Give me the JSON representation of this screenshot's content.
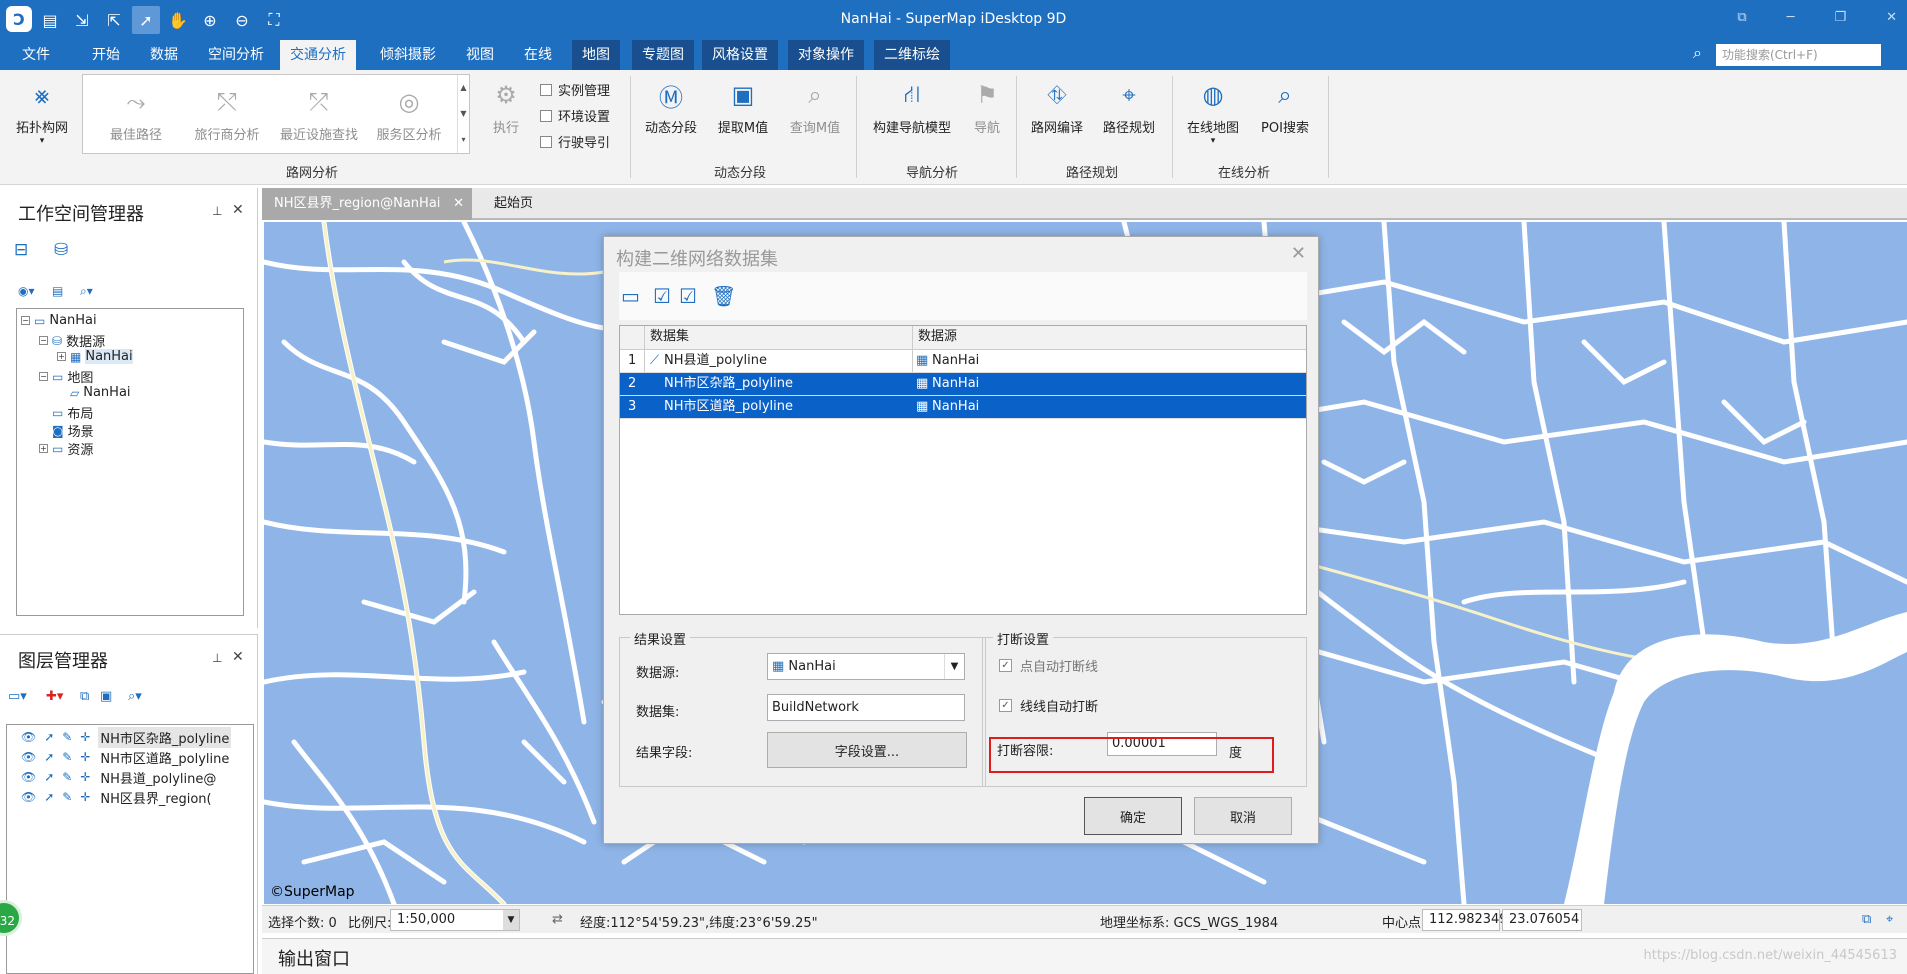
{
  "window": {
    "title": "NanHai - SuperMap iDesktop 9D"
  },
  "menu": {
    "items": [
      "文件",
      "开始",
      "数据",
      "空间分析",
      "交通分析",
      "倾斜摄影",
      "视图",
      "在线",
      "地图",
      "专题图",
      "风格设置",
      "对象操作",
      "二维标绘"
    ],
    "active": "交通分析",
    "search_placeholder": "功能搜索(Ctrl+F)"
  },
  "ribbon": {
    "topo": "拓扑构网",
    "gallery": [
      "最佳路径",
      "旅行商分析",
      "最近设施查找",
      "服务区分析"
    ],
    "execute": "执行",
    "checks": [
      "实例管理",
      "环境设置",
      "行驶导引"
    ],
    "group_network": "路网分析",
    "dynamic": [
      "动态分段",
      "提取M值",
      "查询M值"
    ],
    "group_dynamic": "动态分段",
    "nav": [
      "构建导航模型",
      "导航"
    ],
    "group_nav": "导航分析",
    "route": [
      "路网编译",
      "路径规划"
    ],
    "group_route": "路径规划",
    "online": [
      "在线地图",
      "POI搜索"
    ],
    "group_online": "在线分析"
  },
  "workspace": {
    "title": "工作空间管理器",
    "tree": {
      "root": "NanHai",
      "datasource": "数据源",
      "datasource_child": "NanHai",
      "map": "地图",
      "map_child": "NanHai",
      "layout": "布局",
      "scene": "场景",
      "resource": "资源"
    }
  },
  "layer_manager": {
    "title": "图层管理器",
    "layers": [
      "NH市区杂路_polyline",
      "NH市区道路_polyline",
      "NH县道_polyline@",
      "NH区县界_region("
    ]
  },
  "tabs": [
    "NH区县界_region@NanHai",
    "起始页"
  ],
  "map": {
    "copyright": "©SuperMap"
  },
  "dialog": {
    "title": "构建二维网络数据集",
    "columns": [
      "数据集",
      "数据源"
    ],
    "rows": [
      {
        "no": "1",
        "dataset": "NH县道_polyline",
        "source": "NanHai"
      },
      {
        "no": "2",
        "dataset": "NH市区杂路_polyline",
        "source": "NanHai"
      },
      {
        "no": "3",
        "dataset": "NH市区道路_polyline",
        "source": "NanHai"
      }
    ],
    "result_legend": "结果设置",
    "datasource_label": "数据源:",
    "datasource_value": "NanHai",
    "dataset_label": "数据集:",
    "dataset_value": "BuildNetwork",
    "field_label": "结果字段:",
    "field_btn": "字段设置...",
    "break_legend": "打断设置",
    "point_break": "点自动打断线",
    "line_break": "线线自动打断",
    "tolerance_label": "打断容限:",
    "tolerance_value": "0.00001",
    "tolerance_unit": "度",
    "ok": "确定",
    "cancel": "取消"
  },
  "status": {
    "select_count": "选择个数: 0",
    "scale_label": "比例尺:",
    "scale_value": "1:50,000",
    "coords": "经度:112°54'59.23\",纬度:23°6'59.25\"",
    "crs": "地理坐标系: GCS_WGS_1984",
    "center_label": "中心点:",
    "center_x": "112.982349",
    "center_y": "23.076054"
  },
  "output": {
    "title": "输出窗口"
  },
  "badge": "32",
  "watermark": "https://blog.csdn.net/weixin_44545613"
}
